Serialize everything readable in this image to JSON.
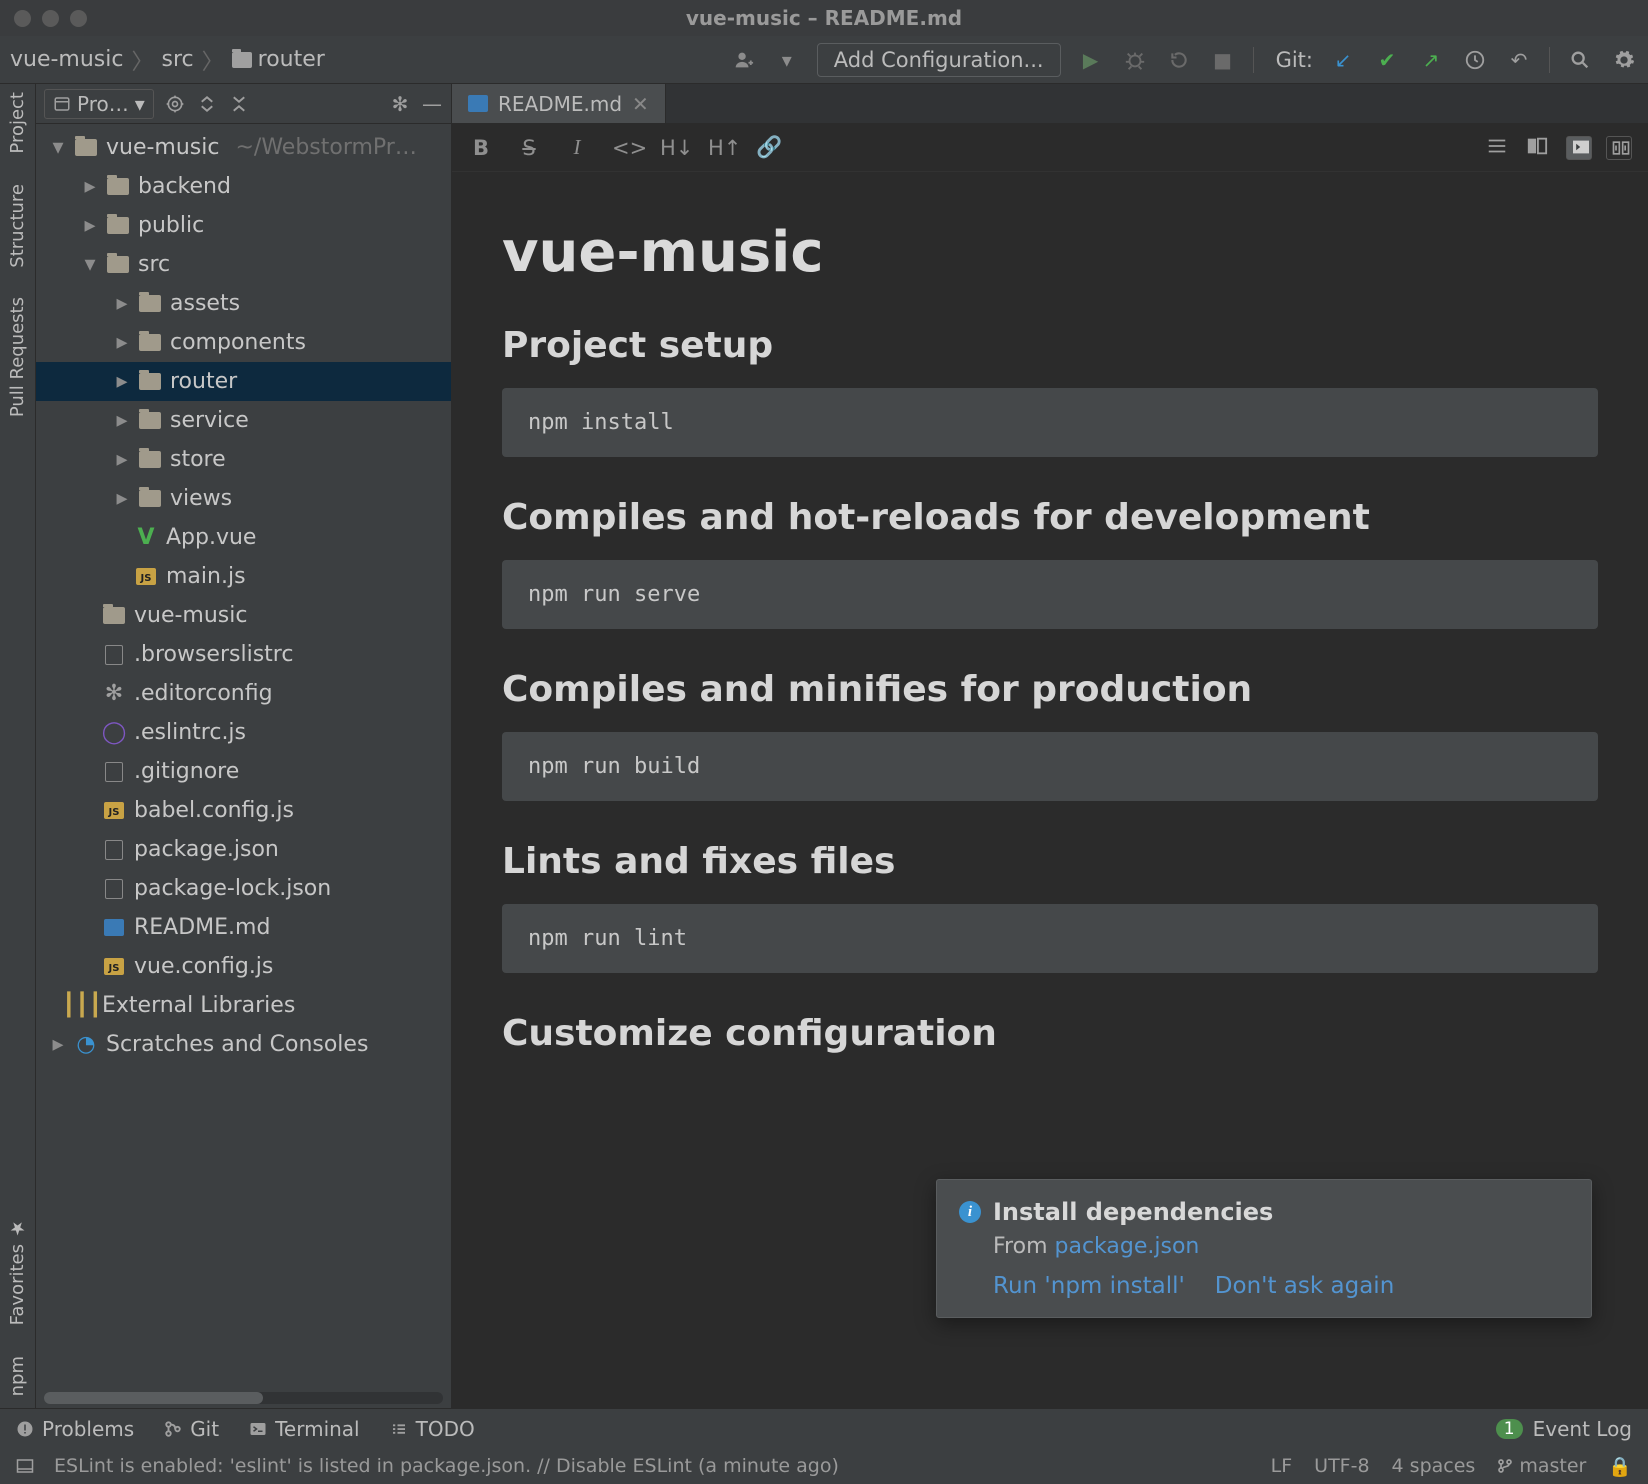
{
  "window": {
    "title": "vue-music – README.md"
  },
  "breadcrumbs": [
    "vue-music",
    "src",
    "router"
  ],
  "toolbar": {
    "add_configuration": "Add Configuration...",
    "git_label": "Git:"
  },
  "left_tools": [
    {
      "id": "project",
      "label": "Project"
    },
    {
      "id": "structure",
      "label": "Structure"
    },
    {
      "id": "pull-requests",
      "label": "Pull Requests"
    },
    {
      "id": "favorites",
      "label": "Favorites"
    },
    {
      "id": "npm",
      "label": "npm"
    }
  ],
  "project_panel": {
    "header": "Pro…",
    "tree": [
      {
        "d": 0,
        "arrow": "v",
        "icon": "folder",
        "label": "vue-music",
        "hint": "~/WebstormPr…"
      },
      {
        "d": 1,
        "arrow": ">",
        "icon": "folder",
        "label": "backend"
      },
      {
        "d": 1,
        "arrow": ">",
        "icon": "folder",
        "label": "public"
      },
      {
        "d": 1,
        "arrow": "v",
        "icon": "folder",
        "label": "src"
      },
      {
        "d": 2,
        "arrow": ">",
        "icon": "folder",
        "label": "assets"
      },
      {
        "d": 2,
        "arrow": ">",
        "icon": "folder",
        "label": "components"
      },
      {
        "d": 2,
        "arrow": ">",
        "icon": "folder",
        "label": "router",
        "selected": true
      },
      {
        "d": 2,
        "arrow": ">",
        "icon": "folder",
        "label": "service"
      },
      {
        "d": 2,
        "arrow": ">",
        "icon": "folder",
        "label": "store"
      },
      {
        "d": 2,
        "arrow": ">",
        "icon": "folder",
        "label": "views"
      },
      {
        "d": 2,
        "arrow": "",
        "icon": "vue",
        "label": "App.vue"
      },
      {
        "d": 2,
        "arrow": "",
        "icon": "js",
        "label": "main.js"
      },
      {
        "d": 1,
        "arrow": "",
        "icon": "folder",
        "label": "vue-music"
      },
      {
        "d": 1,
        "arrow": "",
        "icon": "file",
        "label": ".browserslistrc"
      },
      {
        "d": 1,
        "arrow": "",
        "icon": "gear",
        "label": ".editorconfig"
      },
      {
        "d": 1,
        "arrow": "",
        "icon": "eslint",
        "label": ".eslintrc.js"
      },
      {
        "d": 1,
        "arrow": "",
        "icon": "file",
        "label": ".gitignore"
      },
      {
        "d": 1,
        "arrow": "",
        "icon": "js",
        "label": "babel.config.js"
      },
      {
        "d": 1,
        "arrow": "",
        "icon": "json",
        "label": "package.json"
      },
      {
        "d": 1,
        "arrow": "",
        "icon": "json",
        "label": "package-lock.json"
      },
      {
        "d": 1,
        "arrow": "",
        "icon": "md",
        "label": "README.md"
      },
      {
        "d": 1,
        "arrow": "",
        "icon": "js",
        "label": "vue.config.js"
      },
      {
        "d": 0,
        "arrow": "",
        "icon": "lib",
        "label": "External Libraries"
      },
      {
        "d": 0,
        "arrow": ">",
        "icon": "scratch",
        "label": "Scratches and Consoles"
      }
    ]
  },
  "editor": {
    "tab": {
      "label": "README.md"
    },
    "markdown": {
      "h1": "vue-music",
      "sections": [
        {
          "h": "Project setup",
          "code": "npm install"
        },
        {
          "h": "Compiles and hot-reloads for development",
          "code": "npm run serve"
        },
        {
          "h": "Compiles and minifies for production",
          "code": "npm run build"
        },
        {
          "h": "Lints and fixes files",
          "code": "npm run lint"
        },
        {
          "h": "Customize configuration",
          "code": ""
        }
      ]
    }
  },
  "popup": {
    "title": "Install dependencies",
    "from_prefix": "From ",
    "from_link": "package.json",
    "action_run": "Run 'npm install'",
    "action_dont": "Don't ask again"
  },
  "status_bottom": {
    "problems": "Problems",
    "git": "Git",
    "terminal": "Terminal",
    "todo": "TODO",
    "event_log_badge": "1",
    "event_log": "Event Log"
  },
  "status_footer": {
    "message": "ESLint is enabled: 'eslint' is listed in package.json. // Disable ESLint (a minute ago)",
    "lf": "LF",
    "encoding": "UTF-8",
    "indent": "4 spaces",
    "branch": "master"
  }
}
